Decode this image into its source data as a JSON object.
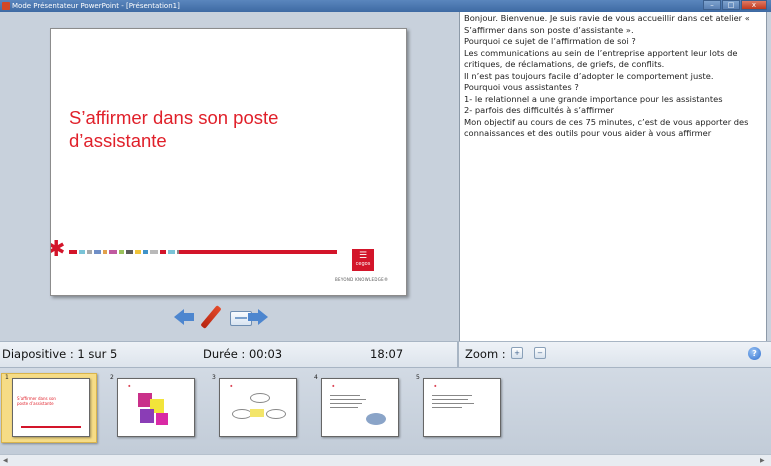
{
  "window": {
    "title": "Mode Présentateur PowerPoint - [Présentation1]",
    "controls": [
      "–",
      "□",
      "x"
    ]
  },
  "slide": {
    "title": "S’affirmer dans son poste d’assistante",
    "logo_text": "cegos",
    "tagline": "BEYOND KNOWLEDGE®"
  },
  "nav": {
    "prev_icon": "arrow-left-icon",
    "pen_icon": "pen-icon",
    "screen_icon": "screen-icon",
    "next_icon": "arrow-right-icon"
  },
  "notes": {
    "lines": [
      "Bonjour. Bienvenue. Je suis ravie de vous accueillir dans cet atelier « S’affirmer dans son poste d’assistante ».",
      "Pourquoi ce sujet de l’affirmation de soi ?",
      "Les communications au sein de l’entreprise apportent leur lots de critiques, de réclamations, de griefs, de conflits.",
      "Il n’est pas toujours facile d’adopter le comportement juste.",
      "Pourquoi vous assistantes ?",
      "1- le relationnel a une grande importance pour les assistantes",
      "2- parfois des difficultés à s’affirmer",
      "Mon objectif au cours de ces 75 minutes, c’est de vous apporter des connaissances et des outils pour vous aider à vous affirmer"
    ]
  },
  "status": {
    "slide_position": "Diapositive : 1 sur 5",
    "duration": "Durée : 00:03",
    "clock": "18:07",
    "zoom_label": "Zoom :",
    "zoom_in_icon": "zoom-in-icon",
    "zoom_out_icon": "zoom-out-icon",
    "help_icon": "help-icon"
  },
  "thumbnails": [
    {
      "number": "1",
      "title": "S’affirmer dans son poste d’assistante",
      "selected": true
    },
    {
      "number": "2",
      "title": "",
      "selected": false
    },
    {
      "number": "3",
      "title": "",
      "selected": false
    },
    {
      "number": "4",
      "title": "",
      "selected": false
    },
    {
      "number": "5",
      "title": "",
      "selected": false
    }
  ],
  "colors": {
    "accent_red": "#d3152a",
    "nav_blue": "#4d86cf",
    "selection_gold": "#f6dc86"
  }
}
